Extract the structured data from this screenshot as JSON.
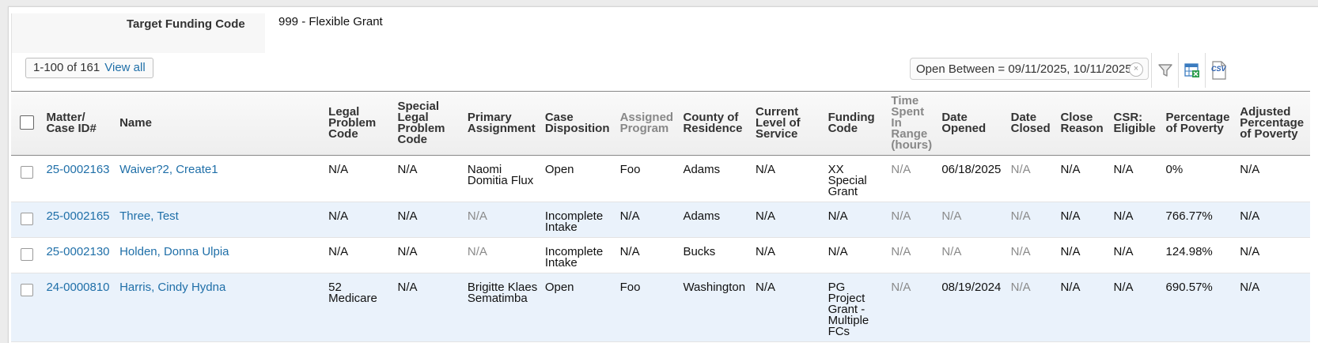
{
  "funding": {
    "label": "Target Funding Code",
    "value": "999 - Flexible Grant"
  },
  "toolbar": {
    "pager_text": "1-100 of 161",
    "view_all": "View all",
    "filter_chip": "Open Between = 09/11/2025, 10/11/2025",
    "filter_clear": "×",
    "icons": [
      "filter-icon",
      "excel-export-icon",
      "csv-export-icon"
    ],
    "csv_label": "CSV"
  },
  "table": {
    "headers": [
      {
        "label": "Matter/ Case ID#"
      },
      {
        "label": "Name"
      },
      {
        "label": "Legal Problem Code"
      },
      {
        "label": "Special Legal Problem Code"
      },
      {
        "label": "Primary Assignment"
      },
      {
        "label": "Case Disposition"
      },
      {
        "label": "Assigned Program",
        "muted": true
      },
      {
        "label": "County of Residence"
      },
      {
        "label": "Current Level of Service"
      },
      {
        "label": "Funding Code"
      },
      {
        "label": "Time Spent In Range (hours)",
        "muted": true
      },
      {
        "label": "Date Opened"
      },
      {
        "label": "Date Closed"
      },
      {
        "label": "Close Reason"
      },
      {
        "label": "CSR: Eligible"
      },
      {
        "label": "Percentage of Poverty"
      },
      {
        "label": "Adjusted Percentage of Poverty"
      }
    ],
    "rows": [
      {
        "cells": [
          "25-0002163",
          "Waiver?2, Create1",
          "N/A",
          "N/A",
          "Naomi Domitia Flux",
          "Open",
          "Foo",
          "Adams",
          "N/A",
          "XX Special Grant",
          "N/A",
          "06/18/2025",
          "N/A",
          "N/A",
          "N/A",
          "0%",
          "N/A"
        ],
        "muted": [
          10,
          12
        ]
      },
      {
        "cells": [
          "25-0002165",
          "Three, Test",
          "N/A",
          "N/A",
          "N/A",
          "Incomplete Intake",
          "N/A",
          "Adams",
          "N/A",
          "N/A",
          "N/A",
          "N/A",
          "N/A",
          "N/A",
          "N/A",
          "766.77%",
          "N/A"
        ],
        "muted": [
          4,
          10,
          11,
          12
        ]
      },
      {
        "cells": [
          "25-0002130",
          "Holden, Donna Ulpia",
          "N/A",
          "N/A",
          "N/A",
          "Incomplete Intake",
          "N/A",
          "Bucks",
          "N/A",
          "N/A",
          "N/A",
          "N/A",
          "N/A",
          "N/A",
          "N/A",
          "124.98%",
          "N/A"
        ],
        "muted": [
          4,
          10,
          11,
          12
        ]
      },
      {
        "cells": [
          "24-0000810",
          "Harris, Cindy Hydna",
          "52 Medicare",
          "N/A",
          "Brigitte Klaes Sematimba",
          "Open",
          "Foo",
          "Washington",
          "N/A",
          "PG Project Grant - Multiple FCs",
          "N/A",
          "08/19/2024",
          "N/A",
          "N/A",
          "N/A",
          "690.57%",
          "N/A"
        ],
        "muted": [
          10,
          12
        ]
      }
    ]
  },
  "colors": {
    "link": "#1f6fa8",
    "row_alt": "#eaf2fb",
    "muted_text": "#8a8a8a"
  }
}
